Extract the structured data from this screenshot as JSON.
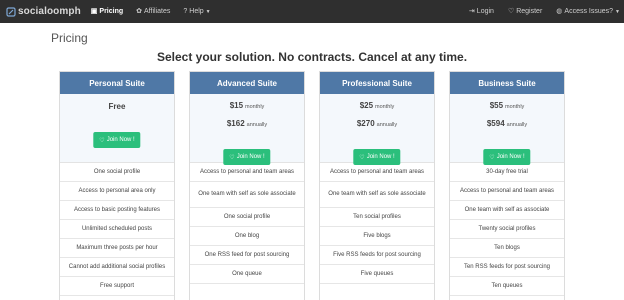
{
  "nav": {
    "brand": "socialoomph",
    "left_items": [
      {
        "label": "Pricing",
        "icon": "calendar-icon"
      },
      {
        "label": "Affiliates",
        "icon": "gift-icon"
      },
      {
        "label": "Help",
        "icon": "question-circle-icon"
      }
    ],
    "right_items": [
      {
        "label": "Login",
        "icon": "login-icon"
      },
      {
        "label": "Register",
        "icon": "heart-icon"
      },
      {
        "label": "Access Issues?",
        "icon": "globe-icon"
      }
    ]
  },
  "page": {
    "title": "Pricing",
    "subtitle": "Select your solution. No contracts. Cancel at any time."
  },
  "plans": [
    {
      "name": "Personal Suite",
      "price_label": "Free",
      "join_label": "Join Now !",
      "features": [
        "One social profile",
        "Access to personal area only",
        "Access to basic posting features",
        "Unlimited scheduled posts",
        "Maximum three posts per hour",
        "Cannot add additional social profiles",
        "Free support"
      ]
    },
    {
      "name": "Advanced Suite",
      "monthly_price": "$15",
      "monthly_unit": "monthly",
      "annual_price": "$162",
      "annual_unit": "annually",
      "join_label": "Join Now !",
      "features": [
        "Access to personal and team areas",
        "One team with self as sole associate",
        "One social profile",
        "One blog",
        "One RSS feed for post sourcing",
        "One queue"
      ]
    },
    {
      "name": "Professional Suite",
      "monthly_price": "$25",
      "monthly_unit": "monthly",
      "annual_price": "$270",
      "annual_unit": "annually",
      "join_label": "Join Now !",
      "features": [
        "Access to personal and team areas",
        "One team with self as sole associate",
        "Ten social profiles",
        "Five blogs",
        "Five RSS feeds for post sourcing",
        "Five queues"
      ]
    },
    {
      "name": "Business Suite",
      "monthly_price": "$55",
      "monthly_unit": "monthly",
      "annual_price": "$594",
      "annual_unit": "annually",
      "join_label": "Join Now !",
      "features": [
        "30-day free trial",
        "Access to personal and team areas",
        "One team with self as associate",
        "Twenty social profiles",
        "Ten blogs",
        "Ten RSS feeds for post sourcing",
        "Ten queues"
      ]
    }
  ],
  "colors": {
    "navbar": "#2f2f2f",
    "plan_header": "#4f78a6",
    "join_button": "#2bbf7c",
    "pricing_bg": "#f4f8fc"
  }
}
